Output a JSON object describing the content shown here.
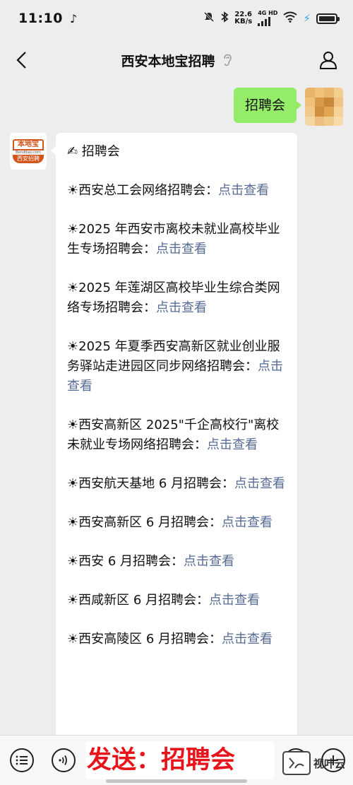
{
  "status_bar": {
    "time": "11:10",
    "speed_value": "22.6",
    "speed_unit": "KB/s",
    "network": "4G HD",
    "icons": [
      "tiktok-icon",
      "mute-icon",
      "bluetooth-icon",
      "signal-icon",
      "wifi-icon",
      "charging-icon",
      "battery-icon"
    ]
  },
  "header": {
    "title": "西安本地宝招聘",
    "icons": [
      "back-arrow-icon",
      "ear-icon",
      "profile-icon"
    ]
  },
  "chat": {
    "outgoing_message": "招聘会",
    "bot_avatar": {
      "logo_top": "本地宝",
      "logo_mid": "Bendibao.com",
      "logo_bottom": "西安招聘",
      "brand_color": "#d2551c"
    },
    "reply": {
      "heading": "✍ 招聘会",
      "entries": [
        {
          "icon": "☀",
          "text": "西安总工会网络招聘会：",
          "link": "点击查看"
        },
        {
          "icon": "☀",
          "text": "2025 年西安市离校未就业高校毕业生专场招聘会：",
          "link": "点击查看"
        },
        {
          "icon": "☀",
          "text": "2025 年莲湖区高校毕业生综合类网络专场招聘会：",
          "link": "点击查看"
        },
        {
          "icon": "☀",
          "text": "2025 年夏季西安高新区就业创业服务驿站走进园区同步网络招聘会：",
          "link": "点击查看"
        },
        {
          "icon": "☀",
          "text": "西安高新区 2025\"千企高校行\"离校未就业专场网络招聘会：",
          "link": "点击查看"
        },
        {
          "icon": "☀",
          "text": "西安航天基地 6 月招聘会：",
          "link": "点击查看"
        },
        {
          "icon": "☀",
          "text": "西安高新区 6 月招聘会：",
          "link": "点击查看"
        },
        {
          "icon": "☀",
          "text": "西安 6 月招聘会：",
          "link": "点击查看"
        },
        {
          "icon": "☀",
          "text": "西咸新区 6 月招聘会：",
          "link": "点击查看"
        },
        {
          "icon": "☀",
          "text": "西安高陵区 6 月招聘会：",
          "link": "点击查看"
        }
      ]
    }
  },
  "input_bar": {
    "value": "发送：招聘会",
    "icons": [
      "menu-icon",
      "voice-icon",
      "emoji-icon",
      "plus-icon"
    ]
  },
  "watermark": {
    "text": "视叶云"
  },
  "colors": {
    "background": "#ededed",
    "outgoing_bubble": "#95ec69",
    "link": "#576b95",
    "input_text": "#e8141c"
  }
}
